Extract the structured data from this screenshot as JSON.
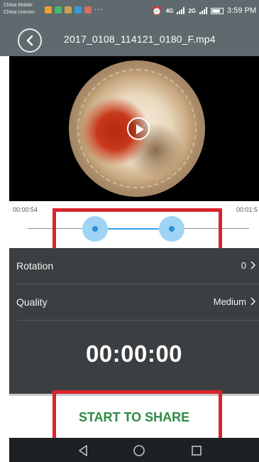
{
  "status_bar": {
    "carrier_1": "China Mobile",
    "carrier_2": "China Unicom",
    "more": "···",
    "network_1": "4G",
    "network_2": "2G",
    "time": "3:59 PM"
  },
  "header": {
    "title": "2017_0108_114121_0180_F.mp4",
    "back_icon": "chevron-left-icon"
  },
  "player": {
    "play_icon": "play-icon"
  },
  "trim": {
    "start_time": "00:00:54",
    "end_time": "00:01:5",
    "highlight_color": "#d9242c",
    "accent_color": "#3aa3e3"
  },
  "settings": {
    "rotation_label": "Rotation",
    "rotation_value": "0",
    "quality_label": "Quality",
    "quality_value": "Medium",
    "timer": "00:00:00"
  },
  "share": {
    "label": "START TO SHARE",
    "color": "#2e8b45"
  },
  "nav": {
    "back_icon": "triangle-back-icon",
    "home_icon": "circle-home-icon",
    "recent_icon": "square-recent-icon"
  }
}
